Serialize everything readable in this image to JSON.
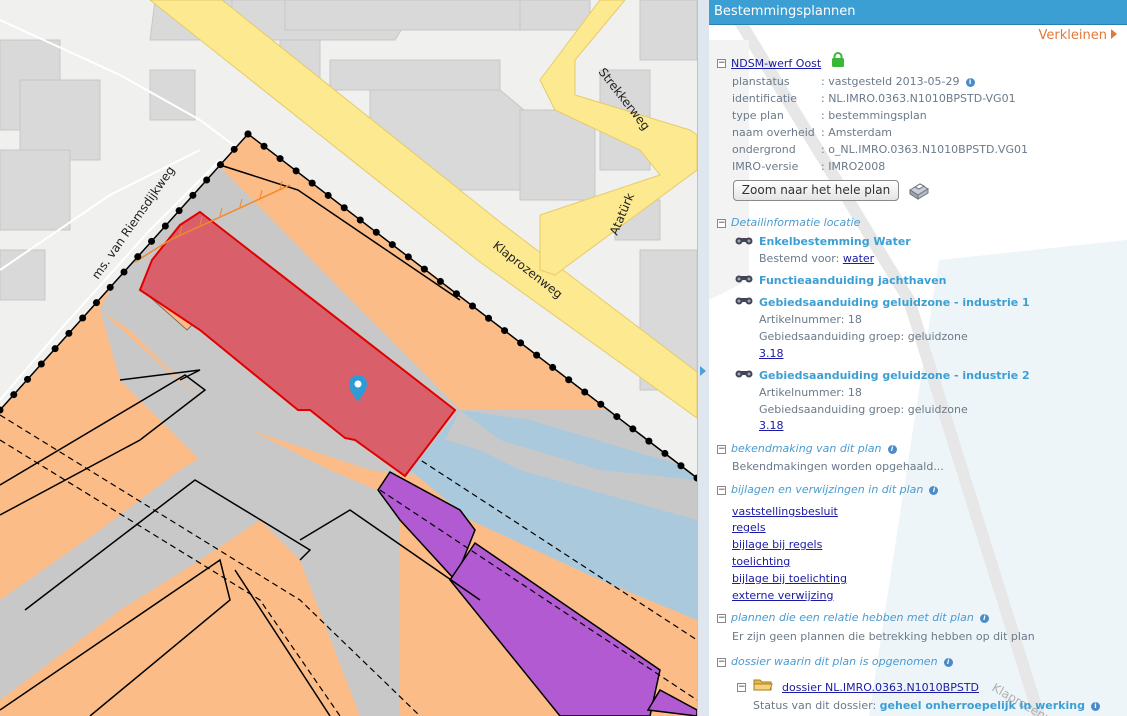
{
  "map": {
    "streets": [
      "Strekkerweg",
      "Atatürk",
      "Klaprozenweg",
      "ms. van Riemsdijkweg",
      "Klaprozenweg"
    ],
    "colors": {
      "background": "#f0f0ee",
      "building": "#d9d9d9",
      "road": "#fde98f",
      "road_edge": "#e5cb6a",
      "plan_orange": "#fcbc87",
      "plan_grey": "#c8c8c8",
      "water_blue": "#aac9dd",
      "purple": "#b25ad2",
      "selection_red": "#e0464f",
      "marker": "#2e9bd6"
    }
  },
  "panel": {
    "title": "Bestemmingsplannen",
    "shrink_label": "Verkleinen",
    "plan": {
      "name": "NDSM-werf Oost",
      "fields": [
        {
          "label": "planstatus",
          "value": "vastgesteld 2013-05-29"
        },
        {
          "label": "identificatie",
          "value": "NL.IMRO.0363.N1010BPSTD-VG01"
        },
        {
          "label": "type plan",
          "value": "bestemmingsplan"
        },
        {
          "label": "naam overheid",
          "value": "Amsterdam"
        },
        {
          "label": "ondergrond",
          "value": "o_NL.IMRO.0363.N1010BPSTD.VG01"
        },
        {
          "label": "IMRO-versie",
          "value": "IMRO2008"
        }
      ],
      "zoom_button": "Zoom naar het hele plan"
    },
    "detail": {
      "heading": "Detailinformatie locatie",
      "item1_title": "Enkelbestemming Water",
      "item1_sub_label": "Bestemd voor:",
      "item1_sub_link": "water",
      "item2_title": "Functieaanduiding jachthaven",
      "item3_title": "Gebiedsaanduiding geluidzone - industrie 1",
      "item3_line1": "Artikelnummer: 18",
      "item3_line2": "Gebiedsaanduiding groep: geluidzone",
      "item3_link": "3.18",
      "item4_title": "Gebiedsaanduiding geluidzone - industrie 2",
      "item4_line1": "Artikelnummer: 18",
      "item4_line2": "Gebiedsaanduiding groep: geluidzone",
      "item4_link": "3.18"
    },
    "bekendmaking": {
      "heading": "bekendmaking van dit plan",
      "text": "Bekendmakingen worden opgehaald..."
    },
    "bijlagen": {
      "heading": "bijlagen en verwijzingen in dit plan",
      "links": [
        "vaststellingsbesluit",
        "regels",
        "bijlage bij regels",
        "toelichting",
        "bijlage bij toelichting",
        "externe verwijzing"
      ]
    },
    "relatie": {
      "heading": "plannen die een relatie hebben met dit plan",
      "text": "Er zijn geen plannen die betrekking hebben op dit plan"
    },
    "dossier": {
      "heading": "dossier waarin dit plan is opgenomen",
      "link": "dossier NL.IMRO.0363.N1010BPSTD",
      "status_label": "Status van dit dossier:",
      "status_value": "geheel onherroepelijk in werking"
    }
  }
}
